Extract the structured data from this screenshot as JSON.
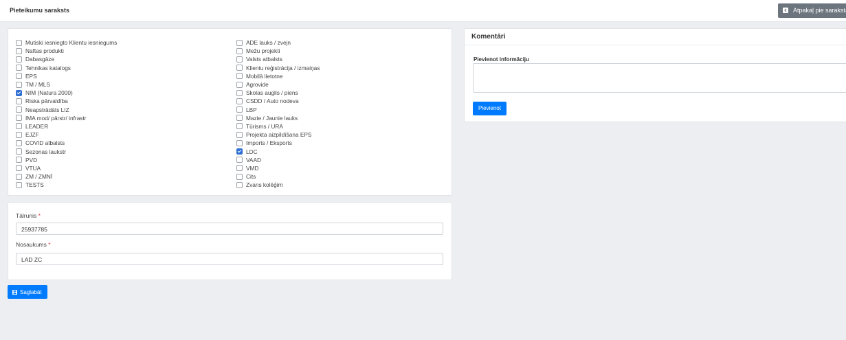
{
  "header": {
    "title": "Pieteikumu saraksts",
    "back_label": "Atpakaļ pie saraksta",
    "back_icon": "arrow-back-square-icon"
  },
  "checklist": {
    "column_1": [
      {
        "label": "Mutiski iesniegto Klientu iesniegums",
        "checked": false
      },
      {
        "label": "Naftas produkti",
        "checked": false
      },
      {
        "label": "Dabasgāze",
        "checked": false
      },
      {
        "label": "Tehnikas katalogs",
        "checked": false
      },
      {
        "label": "EPS",
        "checked": false
      },
      {
        "label": "TM / MLS",
        "checked": false
      },
      {
        "label": "NIM (Natura 2000)",
        "checked": true
      },
      {
        "label": "Riska pārvaldība",
        "checked": false
      },
      {
        "label": "Neapstrādāts LIZ",
        "checked": false
      },
      {
        "label": "IMA mod/ pārstr/ infrastr",
        "checked": false
      },
      {
        "label": "LEADER",
        "checked": false
      },
      {
        "label": "EJZF",
        "checked": false
      },
      {
        "label": "COVID atbalsts",
        "checked": false
      },
      {
        "label": "Sezonas laukstr",
        "checked": false
      },
      {
        "label": "PVD",
        "checked": false
      },
      {
        "label": "VTUA",
        "checked": false
      },
      {
        "label": "ZM / ZMNĪ",
        "checked": false
      },
      {
        "label": "TESTS",
        "checked": false
      }
    ],
    "column_2": [
      {
        "label": "ADE lauks / zvejn",
        "checked": false
      },
      {
        "label": "Mežu projekti",
        "checked": false
      },
      {
        "label": "Valsts atbalsts",
        "checked": false
      },
      {
        "label": "Klientu reģistrācija / izmaiņas",
        "checked": false
      },
      {
        "label": "Mobilā lietotne",
        "checked": false
      },
      {
        "label": "Agrovide",
        "checked": false
      },
      {
        "label": "Skolas auglis / piens",
        "checked": false
      },
      {
        "label": "CSDD / Auto nodeva",
        "checked": false
      },
      {
        "label": "LBP",
        "checked": false
      },
      {
        "label": "Mazie / Jaunie lauks",
        "checked": false
      },
      {
        "label": "Tūrisms / URA",
        "checked": false
      },
      {
        "label": "Projekta aizpildīšana EPS",
        "checked": false
      },
      {
        "label": "Imports / Eksports",
        "checked": false
      },
      {
        "label": "LDC",
        "checked": true
      },
      {
        "label": "VAAD",
        "checked": false
      },
      {
        "label": "VMD",
        "checked": false
      },
      {
        "label": "Cits",
        "checked": false
      },
      {
        "label": "Zvans kolēģim",
        "checked": false
      }
    ]
  },
  "fields": {
    "phone": {
      "label": "Tālrunis",
      "required_mark": "*",
      "value": "25937785"
    },
    "name": {
      "label": "Nosaukums",
      "required_mark": "*",
      "value": "LAD ZC"
    }
  },
  "comments": {
    "title": "Komentāri",
    "add_info_label": "Pievienot informāciju",
    "textarea_value": "",
    "add_button": "Pievienot"
  },
  "save": {
    "label": "Saglabāt",
    "icon": "floppy-disk-icon"
  },
  "colors": {
    "primary": "#007bff",
    "secondary": "#6c757d",
    "checked": "#2f6fd3",
    "required": "#dc3545",
    "background": "#eceef2"
  }
}
